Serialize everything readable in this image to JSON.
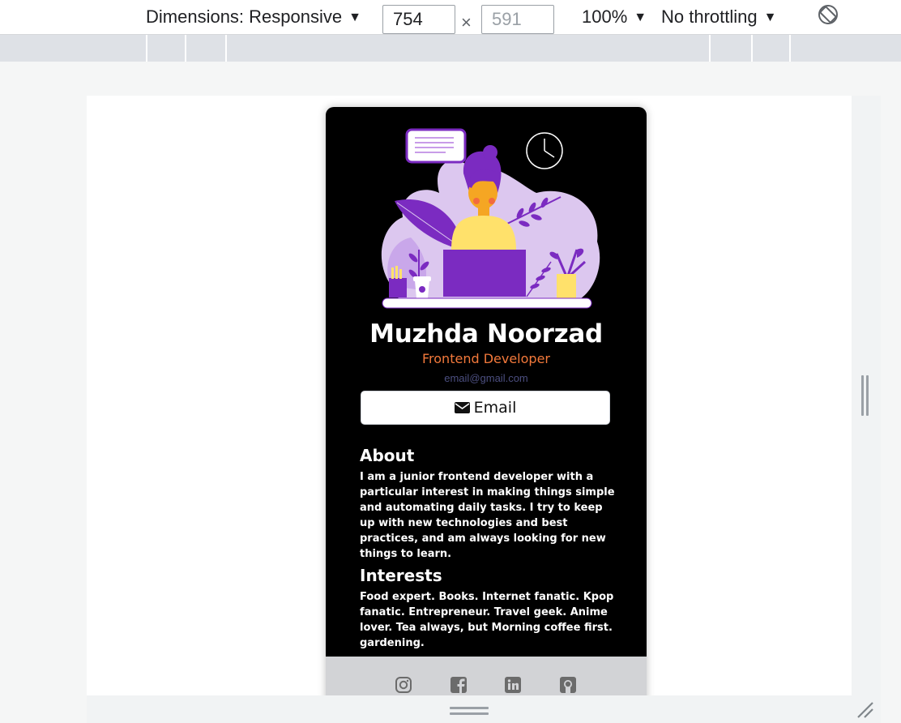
{
  "devtools": {
    "dimensions_label": "Dimensions: Responsive",
    "width_value": "754",
    "height_value": "591",
    "times_sign": "×",
    "zoom_label": "100%",
    "throttling_label": "No throttling",
    "caret": "▼",
    "icons": [
      "caret-down-icon",
      "rotate-icon",
      "resize-handle-icon",
      "corner-grip-icon"
    ]
  },
  "profile": {
    "name": "Muzhda Noorzad",
    "role": "Frontend Developer",
    "email": "email@gmail.com",
    "email_button_label": "Email",
    "about_title": "About",
    "about_text": "I am a junior frontend developer with a particular interest in making things simple and automating daily tasks. I try to keep up with new technologies and best practices, and am always looking for new things to learn.",
    "interests_title": "Interests",
    "interests_text": "Food expert. Books. Internet fanatic. Kpop fanatic. Entrepreneur. Travel geek. Anime lover. Tea always, but Morning coffee first. gardening.",
    "social_icons": [
      "instagram-icon",
      "facebook-icon",
      "linkedin-icon",
      "github-icon"
    ]
  },
  "colors": {
    "card_bg": "#000000",
    "accent_orange": "#f3793b",
    "email_text": "#4c4f80",
    "footer_bg": "#d2d3d6",
    "illustration_purple": "#7b2bc1"
  }
}
